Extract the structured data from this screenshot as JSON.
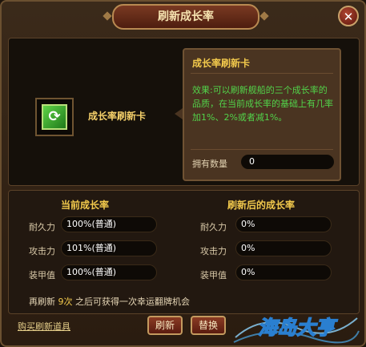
{
  "dialog": {
    "title": "刷新成长率",
    "close_symbol": "✕"
  },
  "item": {
    "name": "成长率刷新卡",
    "icon": "refresh-card-icon",
    "icon_glyph": "⟳"
  },
  "tooltip": {
    "title": "成长率刷新卡",
    "description": "效果:可以刷新舰船的三个成长率的品质，在当前成长率的基础上有几率加1%、2%或者减1%。",
    "owned_label": "拥有数量",
    "owned_value": "0"
  },
  "current": {
    "header": "当前成长率",
    "rows": [
      {
        "label": "耐久力",
        "value": "100%(普通)"
      },
      {
        "label": "攻击力",
        "value": "101%(普通)"
      },
      {
        "label": "装甲值",
        "value": "100%(普通)"
      }
    ]
  },
  "refreshed": {
    "header": "刷新后的成长率",
    "rows": [
      {
        "label": "耐久力",
        "value": "0%"
      },
      {
        "label": "攻击力",
        "value": "0%"
      },
      {
        "label": "装甲值",
        "value": "0%"
      }
    ]
  },
  "refresh_info": {
    "prefix": "再刷新",
    "count": "9次",
    "suffix": "之后可获得一次幸运翻牌机会"
  },
  "buy_link": "购买刷新道具",
  "buttons": {
    "refresh": "刷新",
    "replace": "替换"
  },
  "logo_text": "海岛大亨",
  "colors": {
    "accent_gold": "#f2c94c",
    "effect_green": "#52d34a",
    "button_red": "#8a3b24"
  }
}
